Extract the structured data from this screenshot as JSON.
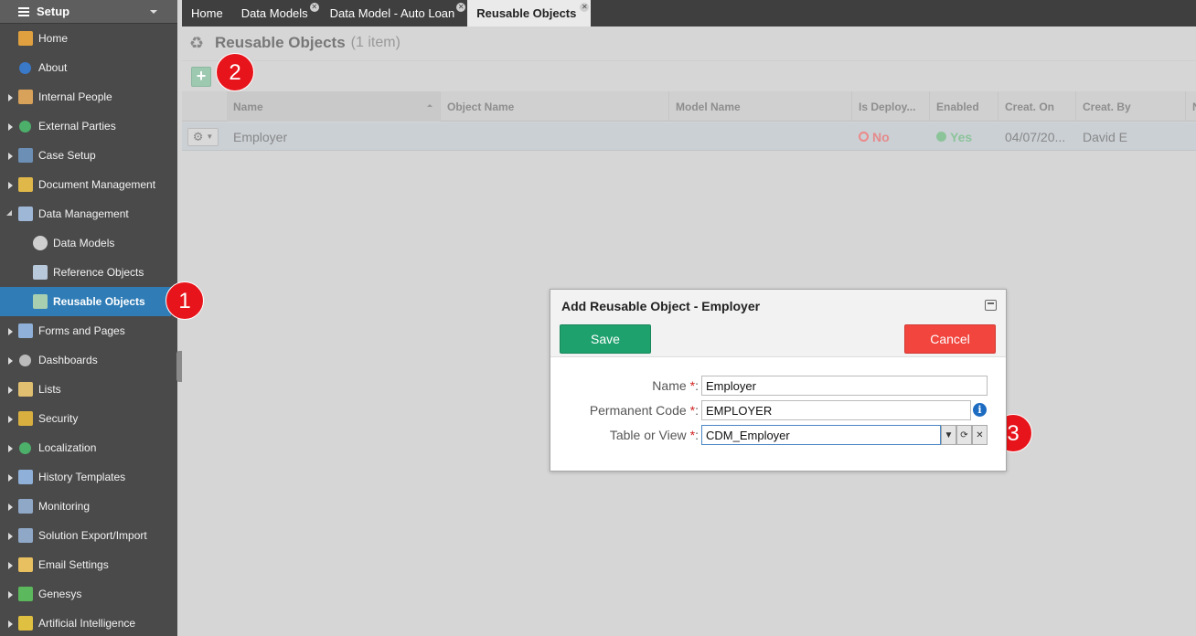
{
  "sidebar": {
    "title": "Setup",
    "items": [
      {
        "label": "Home",
        "icon": "home-icon",
        "level": 0,
        "expandable": false
      },
      {
        "label": "About",
        "icon": "info-icon",
        "level": 0,
        "expandable": false
      },
      {
        "label": "Internal People",
        "icon": "people-icon",
        "level": 0,
        "expandable": true
      },
      {
        "label": "External Parties",
        "icon": "globe-icon",
        "level": 0,
        "expandable": true
      },
      {
        "label": "Case Setup",
        "icon": "case-icon",
        "level": 0,
        "expandable": true
      },
      {
        "label": "Document Management",
        "icon": "folder-icon",
        "level": 0,
        "expandable": true
      },
      {
        "label": "Data Management",
        "icon": "table-icon",
        "level": 0,
        "expandable": true,
        "expanded": true
      },
      {
        "label": "Data Models",
        "icon": "database-icon",
        "level": 1
      },
      {
        "label": "Reference Objects",
        "icon": "reference-icon",
        "level": 1
      },
      {
        "label": "Reusable Objects",
        "icon": "reusable-icon",
        "level": 1,
        "selected": true
      },
      {
        "label": "Forms and Pages",
        "icon": "form-icon",
        "level": 0,
        "expandable": true
      },
      {
        "label": "Dashboards",
        "icon": "dashboard-icon",
        "level": 0,
        "expandable": true
      },
      {
        "label": "Lists",
        "icon": "list-icon",
        "level": 0,
        "expandable": true
      },
      {
        "label": "Security",
        "icon": "lock-icon",
        "level": 0,
        "expandable": true
      },
      {
        "label": "Localization",
        "icon": "globe-icon",
        "level": 0,
        "expandable": true
      },
      {
        "label": "History Templates",
        "icon": "history-icon",
        "level": 0,
        "expandable": true
      },
      {
        "label": "Monitoring",
        "icon": "monitor-icon",
        "level": 0,
        "expandable": true
      },
      {
        "label": "Solution Export/Import",
        "icon": "save-icon",
        "level": 0,
        "expandable": true
      },
      {
        "label": "Email Settings",
        "icon": "email-icon",
        "level": 0,
        "expandable": true
      },
      {
        "label": "Genesys",
        "icon": "puzzle-icon",
        "level": 0,
        "expandable": true
      },
      {
        "label": "Artificial Intelligence",
        "icon": "wand-icon",
        "level": 0,
        "expandable": true
      }
    ]
  },
  "tabs": [
    {
      "label": "Home",
      "closable": false
    },
    {
      "label": "Data Models",
      "closable": true
    },
    {
      "label": "Data Model - Auto Loan",
      "closable": true
    },
    {
      "label": "Reusable Objects",
      "closable": true,
      "active": true
    }
  ],
  "page": {
    "title": "Reusable Objects",
    "count": "(1 item)",
    "add_button": "+"
  },
  "grid": {
    "columns": [
      "Name",
      "Object Name",
      "Model Name",
      "Is Deploy...",
      "Enabled",
      "Creat. On",
      "Creat. By",
      "N"
    ],
    "rows": [
      {
        "name": "Employer",
        "object_name": "",
        "model_name": "",
        "is_deployed": "No",
        "enabled": "Yes",
        "created_on": "04/07/20...",
        "created_by": "David E"
      }
    ]
  },
  "badges": [
    "1",
    "2",
    "3"
  ],
  "dialog": {
    "title": "Add Reusable Object - Employer",
    "save_label": "Save",
    "cancel_label": "Cancel",
    "fields": {
      "name_label": "Name",
      "name_value": "Employer",
      "code_label": "Permanent Code",
      "code_value": "EMPLOYER",
      "table_label": "Table or View",
      "table_value": "CDM_Employer",
      "required_mark": "*",
      "colon": ":"
    }
  },
  "colors": {
    "sidebar_bg": "#4a4a4a",
    "selected": "#2f7cb6",
    "save": "#1fa16e",
    "cancel": "#f1453d",
    "badge": "#e8141b"
  }
}
